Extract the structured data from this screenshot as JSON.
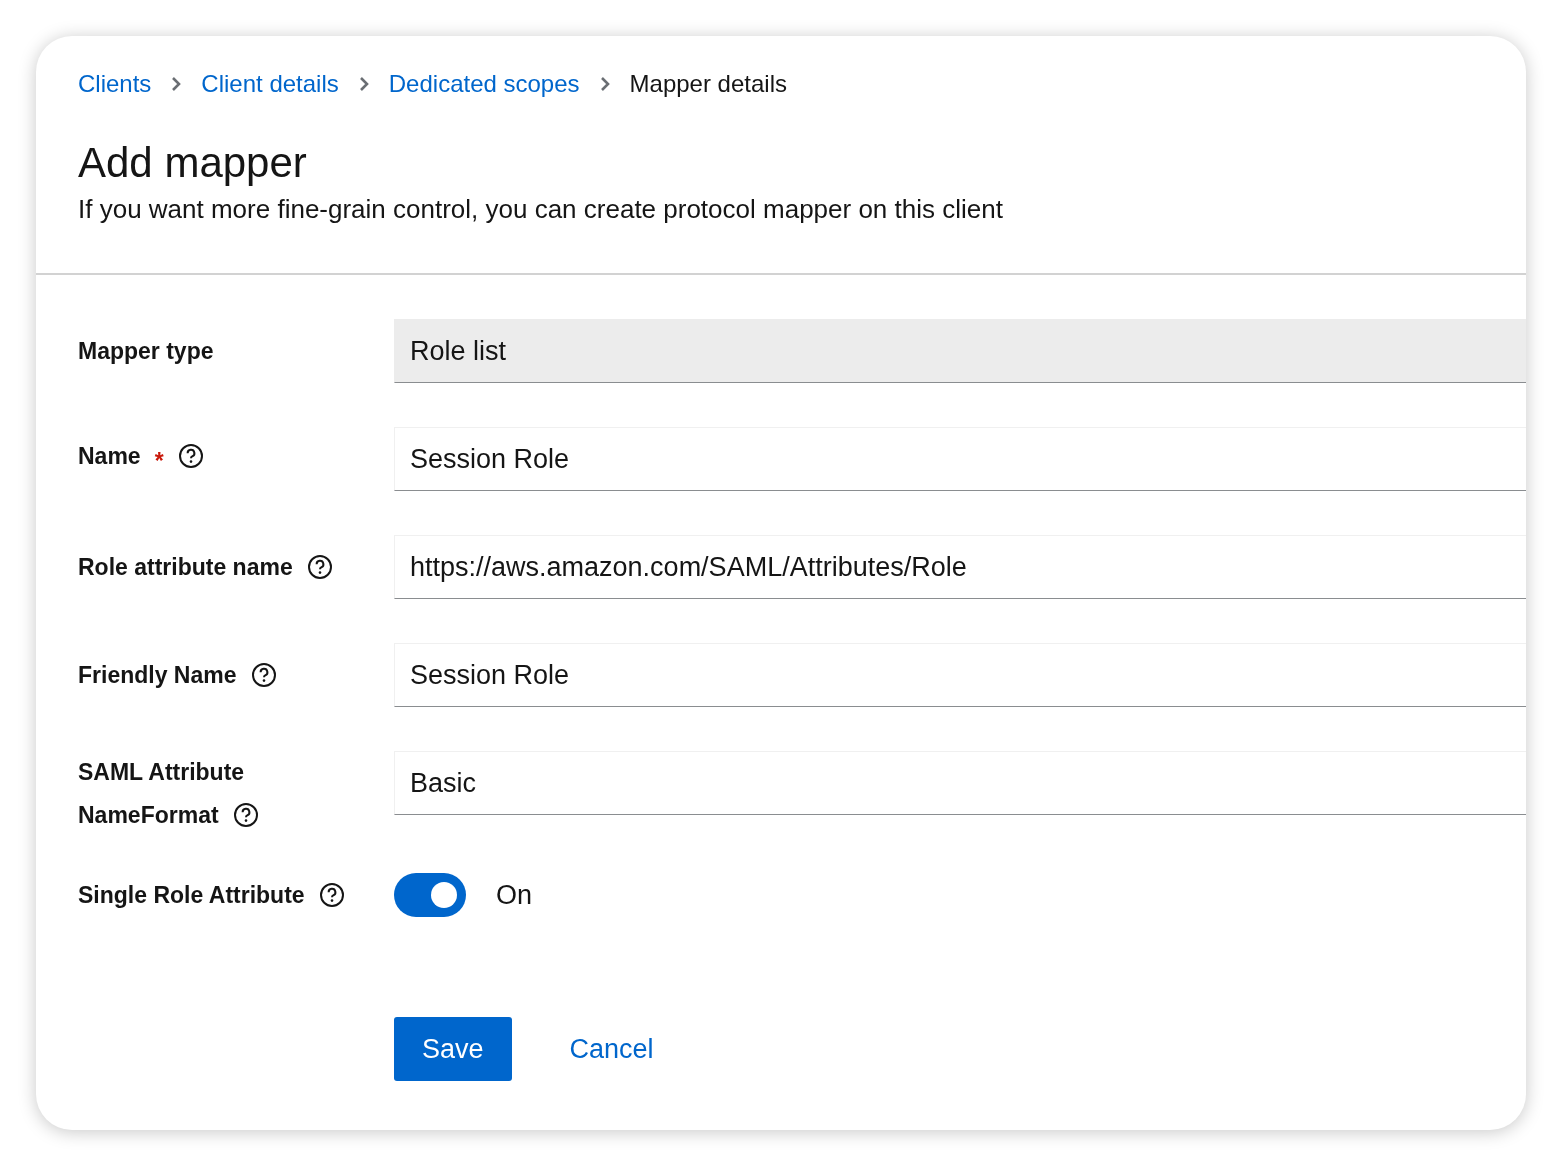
{
  "breadcrumb": [
    {
      "label": "Clients",
      "current": false
    },
    {
      "label": "Client details",
      "current": false
    },
    {
      "label": "Dedicated scopes",
      "current": false
    },
    {
      "label": "Mapper details",
      "current": true
    }
  ],
  "header": {
    "title": "Add mapper",
    "description": "If you want more fine-grain control, you can create protocol mapper on this client"
  },
  "fields": [
    {
      "kind": "text",
      "label": "Mapper type",
      "value": "Role list",
      "readonly": true,
      "help": false
    },
    {
      "kind": "text",
      "label": "Name",
      "required_mark": "*",
      "value": "Session Role",
      "readonly": false,
      "help": true
    },
    {
      "kind": "text",
      "label": "Role attribute name",
      "value": "https://aws.amazon.com/SAML/Attributes/Role",
      "readonly": false,
      "help": true
    },
    {
      "kind": "text",
      "label": "Friendly Name",
      "value": "Session Role",
      "readonly": false,
      "help": true
    },
    {
      "kind": "text",
      "label": "SAML Attribute NameFormat",
      "value": "Basic",
      "readonly": false,
      "help": true
    },
    {
      "kind": "switch",
      "label": "Single Role Attribute",
      "on": true,
      "state_label": "On",
      "help": true
    }
  ],
  "buttons": [
    {
      "label": "Save",
      "kind": "primary"
    },
    {
      "label": "Cancel",
      "kind": "link"
    }
  ]
}
